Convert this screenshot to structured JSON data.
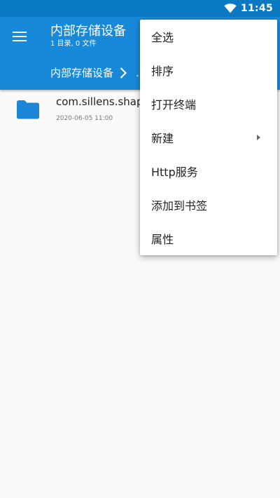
{
  "status_bar": {
    "time": "11:45",
    "wifi_icon": "wifi-icon",
    "color": "#0a79c3"
  },
  "toolbar": {
    "title": "内部存储设备",
    "subtitle": "1 目录, 0 文件",
    "menu_icon": "hamburger-menu-icon",
    "color": "#1889d9"
  },
  "breadcrumb": {
    "items": [
      "内部存储设备",
      "."
    ],
    "separator_icon": "chevron-right-icon"
  },
  "files": [
    {
      "name": "com.sillens.shape",
      "date": "2020-06-05 11:00",
      "icon": "folder-icon",
      "icon_color": "#1b86d6"
    }
  ],
  "overflow_menu": {
    "items": [
      {
        "label": "全选",
        "has_submenu": false
      },
      {
        "label": "排序",
        "has_submenu": false
      },
      {
        "label": "打开终端",
        "has_submenu": false
      },
      {
        "label": "新建",
        "has_submenu": true
      },
      {
        "label": "Http服务",
        "has_submenu": false
      },
      {
        "label": "添加到书签",
        "has_submenu": false
      },
      {
        "label": "属性",
        "has_submenu": false
      }
    ]
  }
}
